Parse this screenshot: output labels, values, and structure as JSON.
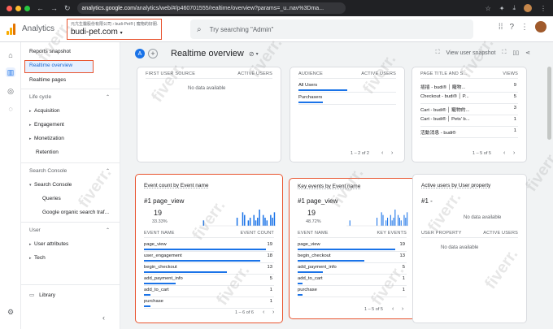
{
  "browser": {
    "url_host": "analytics.google.com",
    "url_rest": "/analytics/web/#/p460701555/realtime/overview?params=_u..nav%3Dma..."
  },
  "header": {
    "app_name": "Analytics",
    "property_path": "元亢生醫股份有限公司 › budi-Pet® | 寵物的好朋...",
    "property_name": "budi-pet.com",
    "search_placeholder": "Try searching \"Admin\""
  },
  "sidebar": {
    "reports_snapshot": "Reports snapshot",
    "realtime_overview": "Realtime overview",
    "realtime_pages": "Realtime pages",
    "life_cycle": "Life cycle",
    "acquisition": "Acquisition",
    "engagement": "Engagement",
    "monetization": "Monetization",
    "retention": "Retention",
    "search_console_head": "Search Console",
    "search_console": "Search Console",
    "queries": "Queries",
    "organic": "Google organic search traf...",
    "user_head": "User",
    "user_attributes": "User attributes",
    "tech": "Tech",
    "library": "Library"
  },
  "subbar": {
    "chip_letter": "A",
    "title": "Realtime overview",
    "snapshot": "View user snapshot"
  },
  "card_first_source": {
    "col1": "FIRST USER SOURCE",
    "col2": "ACTIVE USERS",
    "no_data": "No data available"
  },
  "card_audience": {
    "col1": "AUDIENCE",
    "col2": "ACTIVE USERS",
    "rows": [
      {
        "name": "All Users",
        "value": "",
        "frac": 1.0
      },
      {
        "name": "Purchasers",
        "value": "",
        "frac": 0.5
      }
    ],
    "pager": "1 – 2 of 2"
  },
  "card_pages": {
    "col1": "PAGE TITLE AND S...",
    "col2": "VIEWS",
    "rows": [
      {
        "name": "插插 - budi® │ 寵物...",
        "value": "9"
      },
      {
        "name": "Checkout - budi® │ P...",
        "value": "5"
      },
      {
        "name": "Cart - budi® │ 寵物的...",
        "value": "3"
      },
      {
        "name": "Cart - budi® │ Pets' b...",
        "value": "1"
      },
      {
        "name": "活動消息 - budi®",
        "value": "1"
      }
    ],
    "pager": "1 – 5 of 5"
  },
  "card_events": {
    "title": "Event count by Event name",
    "top_label": "#1  page_view",
    "top_value": "19",
    "top_pct": "33.33%",
    "col1": "EVENT NAME",
    "col2": "EVENT COUNT",
    "rows": [
      {
        "name": "page_view",
        "value": "19",
        "frac": 1.0
      },
      {
        "name": "user_engagement",
        "value": "18",
        "frac": 0.95
      },
      {
        "name": "begin_checkout",
        "value": "13",
        "frac": 0.68
      },
      {
        "name": "add_payment_info",
        "value": "5",
        "frac": 0.26
      },
      {
        "name": "add_to_cart",
        "value": "1",
        "frac": 0.05
      },
      {
        "name": "purchase",
        "value": "1",
        "frac": 0.05
      }
    ],
    "pager": "1 – 6 of 6",
    "spark": [
      0,
      0,
      2,
      0,
      0,
      0,
      0,
      0,
      0,
      0,
      0,
      0,
      0,
      0,
      0,
      0,
      0,
      0,
      0,
      0,
      3,
      0,
      0,
      5,
      4,
      0,
      2,
      3,
      0,
      4,
      2,
      3,
      6,
      0,
      4,
      3,
      2,
      0,
      4,
      3,
      5
    ]
  },
  "card_key_events": {
    "title": "Key events by Event name",
    "top_label": "#1  page_view",
    "top_value": "19",
    "top_pct": "48.72%",
    "col1": "EVENT NAME",
    "col2": "KEY EVENTS",
    "rows": [
      {
        "name": "page_view",
        "value": "19",
        "frac": 1.0
      },
      {
        "name": "begin_checkout",
        "value": "13",
        "frac": 0.68
      },
      {
        "name": "add_payment_info",
        "value": "5",
        "frac": 0.26
      },
      {
        "name": "add_to_cart",
        "value": "1",
        "frac": 0.05
      },
      {
        "name": "purchase",
        "value": "1",
        "frac": 0.05
      }
    ],
    "pager": "1 – 5 of 5",
    "spark": [
      0,
      0,
      2,
      0,
      0,
      0,
      0,
      0,
      0,
      0,
      0,
      0,
      0,
      0,
      0,
      0,
      0,
      0,
      0,
      0,
      3,
      0,
      0,
      5,
      4,
      0,
      2,
      3,
      0,
      4,
      2,
      3,
      6,
      0,
      4,
      3,
      2,
      0,
      4,
      3,
      5
    ]
  },
  "card_user_property": {
    "title": "Active users by User property",
    "top_label": "#1  -",
    "col1": "USER PROPERTY",
    "col2": "ACTIVE USERS",
    "no_data": "No data available"
  },
  "watermark": "fiverr.",
  "colors": {
    "accent": "#1a73e8",
    "highlight": "#e8542f"
  }
}
